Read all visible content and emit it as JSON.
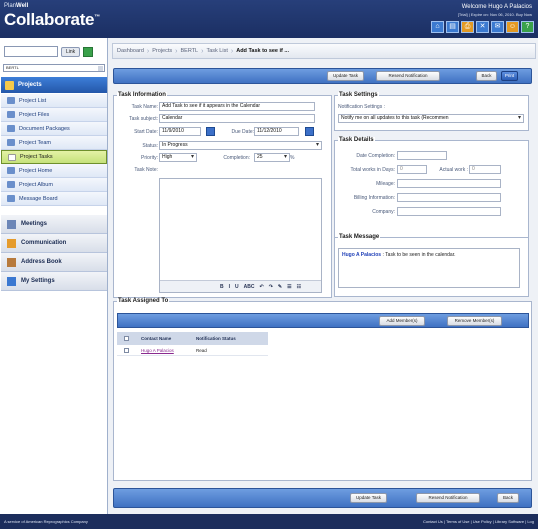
{
  "header": {
    "brand_small_prefix": "Plan",
    "brand_small_bold": "Well",
    "brand_big": "Collaborate",
    "brand_tm": "™",
    "welcome": "Welcome Hugo A Palacios",
    "welcome_sub": "[Trial] | Expire on: Nov 06, 2010. Buy Now",
    "icons": [
      "home-icon",
      "folder-icon",
      "print-icon",
      "close-icon",
      "mail-icon",
      "user-icon",
      "help-icon"
    ]
  },
  "sidebar": {
    "search_button": "Link",
    "project_select": "BERTL",
    "section_title": "Projects",
    "items": [
      {
        "label": "Project List",
        "icon": "list-icon"
      },
      {
        "label": "Project Files",
        "icon": "folder-icon"
      },
      {
        "label": "Document Packages",
        "icon": "package-icon"
      },
      {
        "label": "Project Team",
        "icon": "team-icon"
      },
      {
        "label": "Project Tasks",
        "icon": "task-icon",
        "active": true
      },
      {
        "label": "Project Home",
        "icon": "home-icon"
      },
      {
        "label": "Project Album",
        "icon": "album-icon"
      },
      {
        "label": "Message Board",
        "icon": "message-icon"
      }
    ],
    "sections": [
      {
        "label": "Meetings",
        "icon": "meetings-icon"
      },
      {
        "label": "Communication",
        "icon": "communication-icon"
      },
      {
        "label": "Address Book",
        "icon": "address-book-icon"
      },
      {
        "label": "My Settings",
        "icon": "settings-icon"
      }
    ]
  },
  "breadcrumb": [
    "Dashboard",
    "Projects",
    "BERTL",
    "Task List"
  ],
  "breadcrumb_current": "Add Task to see if ...",
  "toolbar": {
    "update": "Update Task",
    "resend": "Resend Notification",
    "back": "Back",
    "print": "Print"
  },
  "task_info": {
    "title": "Task Information",
    "name_label": "Task Name:",
    "name_value": "Add Task to see if it appears in the Calendar",
    "subject_label": "Task subject:",
    "subject_value": "Calendar",
    "start_label": "Start Date:",
    "start_value": "11/9/2010",
    "due_label": "Due Date:",
    "due_value": "11/12/2010",
    "status_label": "Status:",
    "status_value": "In Progress",
    "priority_label": "Priority:",
    "priority_value": "High",
    "completion_label": "Completion:",
    "completion_value": "25",
    "completion_unit": "%",
    "note_label": "Task Note:",
    "editor_tools": [
      "B",
      "I",
      "U",
      "ABC",
      "↶",
      "↷",
      "✎",
      "☰",
      "☷"
    ]
  },
  "task_settings": {
    "title": "Task Settings",
    "notification_label": "Notification Settings :",
    "notification_value": "Notify me on all updates to this task (Recommen"
  },
  "task_details": {
    "title": "Task Details",
    "date_completion_label": "Date Completion:",
    "total_works_label": "Total works in Days:",
    "total_works_value": "0",
    "actual_work_label": "Actual work :",
    "actual_work_value": "0",
    "mileage_label": "Mileage:",
    "billing_label": "Billing Information:",
    "company_label": "Company:"
  },
  "task_message": {
    "title": "Task Message",
    "author": "Hugo A Palacios",
    "text": " : Task to be seen in the calendar."
  },
  "assigned": {
    "title": "Task Assigned To",
    "add_member": "Add Member(s)",
    "remove_member": "Remove Member(s)",
    "columns": [
      "Contact Name",
      "Notification Status"
    ],
    "rows": [
      {
        "name": "Hugo A Palacios",
        "status": "Read"
      }
    ]
  },
  "bottom_toolbar": {
    "update": "Update Task",
    "resend": "Resend Notification",
    "back": "Back"
  },
  "footer": {
    "left": "A service of American Reprographics Company",
    "right": "Contact Us | Terms of Use | Use Policy | Library Software | Log"
  }
}
